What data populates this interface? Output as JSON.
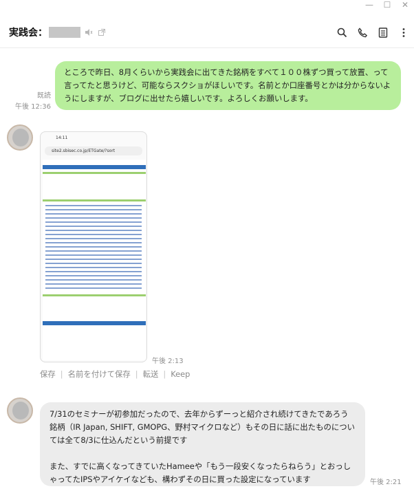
{
  "window": {
    "controls": {
      "minimize": "—",
      "maximize": "☐",
      "close": "✕"
    }
  },
  "header": {
    "title": "実践会：",
    "icons": [
      "speaker-muted-icon",
      "external-window-icon",
      "search-icon",
      "phone-icon",
      "notes-icon",
      "more-icon"
    ]
  },
  "messages": {
    "m1": {
      "text": "ところで昨日、8月くらいから実践会に出てきた銘柄をすべて１００株ずつ買って放置、って言ってたと思うけど、可能ならスクショがほしいです。名前とか口座番号とかは分からないようにしますが、ブログに出せたら嬉しいです。よろしくお願いします。",
      "read": "既読",
      "time": "午後 12:36"
    },
    "m2": {
      "status_time": "14:11",
      "url": "site2.sbisec.co.jp/ETGate/?sort",
      "time": "午後 2:13",
      "actions": {
        "save": "保存",
        "save_as": "名前を付けて保存",
        "forward": "転送",
        "keep": "Keep"
      }
    },
    "m3": {
      "para1": "7/31のセミナーが初参加だったので、去年からずーっと紹介され続けてきたであろう銘柄（IR Japan, SHIFT, GMOPG、野村マイクロなど）もその日に話に出たものについては全て8/3に仕込んだという前提です",
      "para2": "また、すでに高くなってきていたHameeや「もう一段安くなったらねらう」とおっしゃってたIPSやアイケイなども、構わずその日に買った設定になっています",
      "time": "午後 2:21"
    }
  },
  "colors": {
    "my_bubble": "#b8ee9c",
    "other_bubble": "#ececec",
    "meta_text": "#8f8f8f"
  }
}
